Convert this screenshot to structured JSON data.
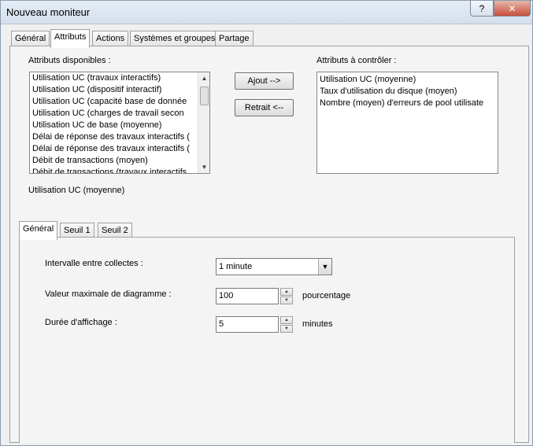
{
  "window": {
    "title": "Nouveau moniteur",
    "help_label": "?",
    "close_label": "✕"
  },
  "tabs": [
    {
      "label": "Général",
      "active": false
    },
    {
      "label": "Attributs",
      "active": true
    },
    {
      "label": "Actions",
      "active": false
    },
    {
      "label": "Systèmes et groupes",
      "active": false
    },
    {
      "label": "Partage",
      "active": false
    }
  ],
  "available": {
    "label": "Attributs disponibles :",
    "items": [
      "Utilisation UC (travaux interactifs)",
      "Utilisation UC (dispositif interactif)",
      "Utilisation UC (capacité base de donnée",
      "Utilisation UC (charges de travail secon",
      "Utilisation UC de base (moyenne)",
      "Délai de réponse des travaux interactifs (",
      "Délai de réponse des travaux interactifs (",
      "Débit de transactions (moyen)",
      "Débit de transactions (travaux interactifs"
    ],
    "scroll_up": "▲",
    "scroll_down": "▼"
  },
  "buttons": {
    "add": "Ajout -->",
    "remove": "Retrait <--"
  },
  "monitored": {
    "label": "Attributs à contrôler :",
    "items": [
      "Utilisation UC (moyenne)",
      "Taux d'utilisation du disque (moyen)",
      "Nombre (moyen) d'erreurs de pool utilisate"
    ]
  },
  "selected_attribute": "Utilisation UC (moyenne)",
  "subtabs": [
    {
      "label": "Général",
      "active": true
    },
    {
      "label": "Seuil 1",
      "active": false
    },
    {
      "label": "Seuil 2",
      "active": false
    }
  ],
  "settings": {
    "interval": {
      "label": "Intervalle entre collectes :",
      "value": "1  minute",
      "dropdown_icon": "▼"
    },
    "max_value": {
      "label": "Valeur maximale de diagramme :",
      "value": "100",
      "unit": "pourcentage"
    },
    "duration": {
      "label": "Durée d'affichage :",
      "value": "5",
      "unit": "minutes"
    },
    "spin_up": "▲",
    "spin_down": "▼"
  }
}
